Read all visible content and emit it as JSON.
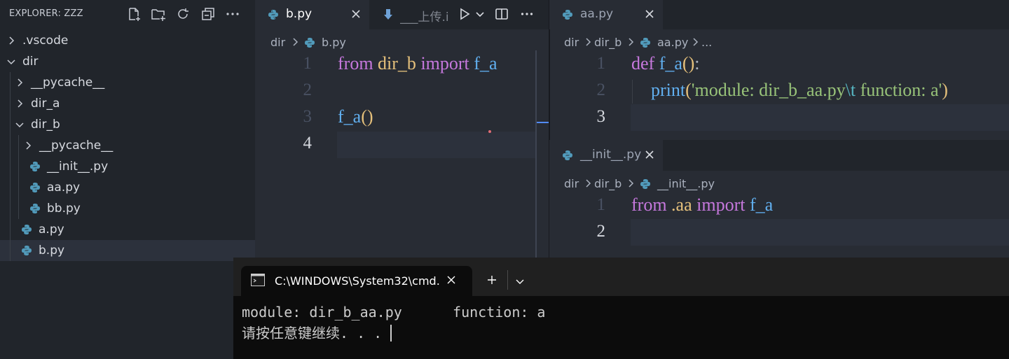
{
  "explorer": {
    "title": "EXPLORER: ZZZ",
    "actions": [
      "new-file-icon",
      "new-folder-icon",
      "refresh-icon",
      "collapse-all-icon",
      "more-icon"
    ],
    "tree": [
      {
        "label": ".vscode",
        "kind": "folder",
        "expanded": false,
        "depth": 0
      },
      {
        "label": "dir",
        "kind": "folder",
        "expanded": true,
        "depth": 0
      },
      {
        "label": "__pycache__",
        "kind": "folder",
        "expanded": false,
        "depth": 1
      },
      {
        "label": "dir_a",
        "kind": "folder",
        "expanded": false,
        "depth": 1
      },
      {
        "label": "dir_b",
        "kind": "folder",
        "expanded": true,
        "depth": 1
      },
      {
        "label": "__pycache__",
        "kind": "folder",
        "expanded": false,
        "depth": 2
      },
      {
        "label": "__init__.py",
        "kind": "py",
        "depth": 2
      },
      {
        "label": "aa.py",
        "kind": "py",
        "depth": 2
      },
      {
        "label": "bb.py",
        "kind": "py",
        "depth": 2
      },
      {
        "label": "a.py",
        "kind": "py",
        "depth": 1
      },
      {
        "label": "b.py",
        "kind": "py",
        "depth": 1,
        "selected": true
      }
    ]
  },
  "editor1": {
    "tabs": [
      {
        "label": "b.py",
        "active": true
      },
      {
        "label": "___上传.i",
        "active": false
      }
    ],
    "breadcrumb": [
      "dir",
      "b.py"
    ],
    "line_numbers": [
      "1",
      "2",
      "3",
      "4"
    ],
    "code": {
      "l1_kw1": "from",
      "l1_mod": "dir_b",
      "l1_kw2": "import",
      "l1_fn": "f_a",
      "l3_fn": "f_a",
      "l3_paren": "()"
    }
  },
  "editor2": {
    "tab": "aa.py",
    "breadcrumb": [
      "dir",
      "dir_b",
      "aa.py",
      "..."
    ],
    "line_numbers": [
      "1",
      "2",
      "3"
    ],
    "code": {
      "l1_kw": "def",
      "l1_fn": "f_a",
      "l1_paren": "()",
      "l1_colon": ":",
      "l2_fn": "print",
      "l2_open": "(",
      "l2_str1": "'module: dir_b_aa.py",
      "l2_esc": "\\t",
      "l2_str2": " function: a'",
      "l2_close": ")"
    }
  },
  "editor3": {
    "tab": "__init__.py",
    "breadcrumb": [
      "dir",
      "dir_b",
      "__init__.py"
    ],
    "line_numbers": [
      "1",
      "2"
    ],
    "code": {
      "l1_kw1": "from",
      "l1_mod": ".aa",
      "l1_kw2": "import",
      "l1_fn": "f_a"
    }
  },
  "terminal": {
    "tab_title": "C:\\WINDOWS\\System32\\cmd.",
    "lines": [
      "module: dir_b_aa.py      function: a",
      "请按任意键继续. . . "
    ]
  },
  "colors": {
    "keyword": "#c678dd",
    "module": "#e5c07b",
    "function": "#61afef",
    "string": "#98c379",
    "escape": "#56b6c2",
    "py_icon": "#519aba"
  }
}
